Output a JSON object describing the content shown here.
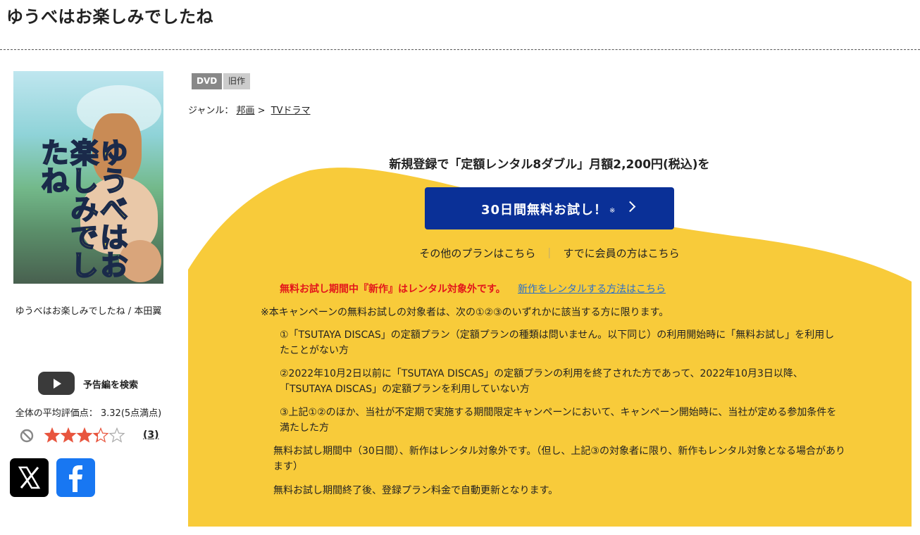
{
  "title": "ゆうべはお楽しみでしたね",
  "cover": {
    "title_art": "ゆうべはお楽しみでしたね",
    "caption": "ゆうべはお楽しみでしたね / 本田翼"
  },
  "trailer": {
    "label": "予告編を検索"
  },
  "rating": {
    "summary": "全体の平均評価点： 3.32(5点満点)",
    "stars_value": 3.32,
    "stars_max": 5,
    "count": "(3)"
  },
  "badges": {
    "format": "DVD",
    "category": "旧作"
  },
  "genre": {
    "prefix": "ジャンル：",
    "main": "邦画",
    "arrow": ">",
    "sub": "TVドラマ"
  },
  "promo": {
    "heading": "新規登録で「定額レンタル8ダブル」月額2,200円(税込)を",
    "trial_button": "30日間無料お試し！",
    "trial_mark": "※",
    "other_plans": "その他のプランはこちら",
    "separator": "｜",
    "members": "すでに会員の方はこちら",
    "notice_red": "無料お試し期間中『新作』はレンタル対象外です。",
    "notice_link": "新作をレンタルする方法はこちら",
    "terms_intro": "※本キャンペーンの無料お試しの対象者は、次の①②③のいずれかに該当する方に限ります。",
    "terms": [
      "①「TSUTAYA DISCAS」の定額プラン（定額プランの種類は問いません。以下同じ）の利用開始時に「無料お試し」を利用したことがない方",
      "②2022年10月2日以前に「TSUTAYA DISCAS」の定額プランの利用を終了された方であって、2022年10月3日以降、「TSUTAYA DISCAS」の定額プランを利用していない方",
      "③上記①②のほか、当社が不定期で実施する期間限定キャンペーンにおいて、キャンペーン開始時に、当社が定める参加条件を満たした方"
    ],
    "note1": "無料お試し期間中（30日間）、新作はレンタル対象外です。（但し、上記③の対象者に限り、新作もレンタル対象となる場合があります）",
    "note2": "無料お試し期間終了後、登録プラン料金で自動更新となります。"
  },
  "colors": {
    "promo_yellow": "#f8cb3a",
    "button_blue": "#0a3097",
    "red": "#e3161b",
    "link": "#2a6fc9",
    "star": "#e8553e"
  },
  "icons": [
    "play-icon",
    "ban-icon",
    "star-icon",
    "x-icon",
    "facebook-icon",
    "chevron-right-icon"
  ]
}
